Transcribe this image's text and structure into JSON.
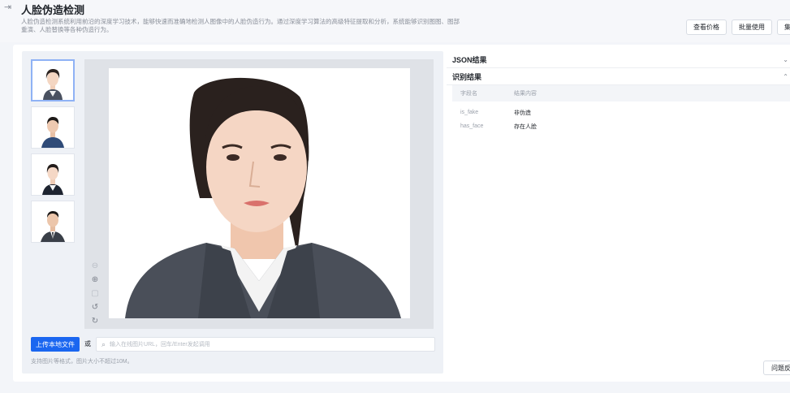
{
  "header": {
    "title": "人脸伪造检测",
    "description": "人脸伪造检测系统利用前沿的深度学习技术，能够快速而准确地检测人图像中的人脸伪造行为。通过深度学习算法的高级特征提取和分析，系统能够识别图图、图部重演、人脸替换等各种伪造行为。",
    "actions": [
      "查看价格",
      "批量使用",
      "集成"
    ]
  },
  "thumbnails": [
    {
      "name": "woman-long-hair",
      "active": true
    },
    {
      "name": "man-short-hair",
      "active": false
    },
    {
      "name": "woman-bun",
      "active": false
    },
    {
      "name": "man-suit",
      "active": false
    }
  ],
  "upload": {
    "button_label": "上传本地文件",
    "or_label": "或",
    "url_placeholder": "输入在线图片URL，回车/Enter发起调用",
    "hint": "支持图片等格式，图片大小不超过10M。"
  },
  "results": {
    "json_section": "JSON结果",
    "recognition_section": "识别结果",
    "columns": [
      "字段名",
      "结果内容"
    ],
    "rows": [
      {
        "field": "is_fake",
        "value": "非伪造"
      },
      {
        "field": "has_face",
        "value": "存在人脸"
      }
    ]
  },
  "feedback_label": "问题反馈",
  "colors": {
    "primary": "#1a66f0",
    "panel": "#eef1f6"
  }
}
